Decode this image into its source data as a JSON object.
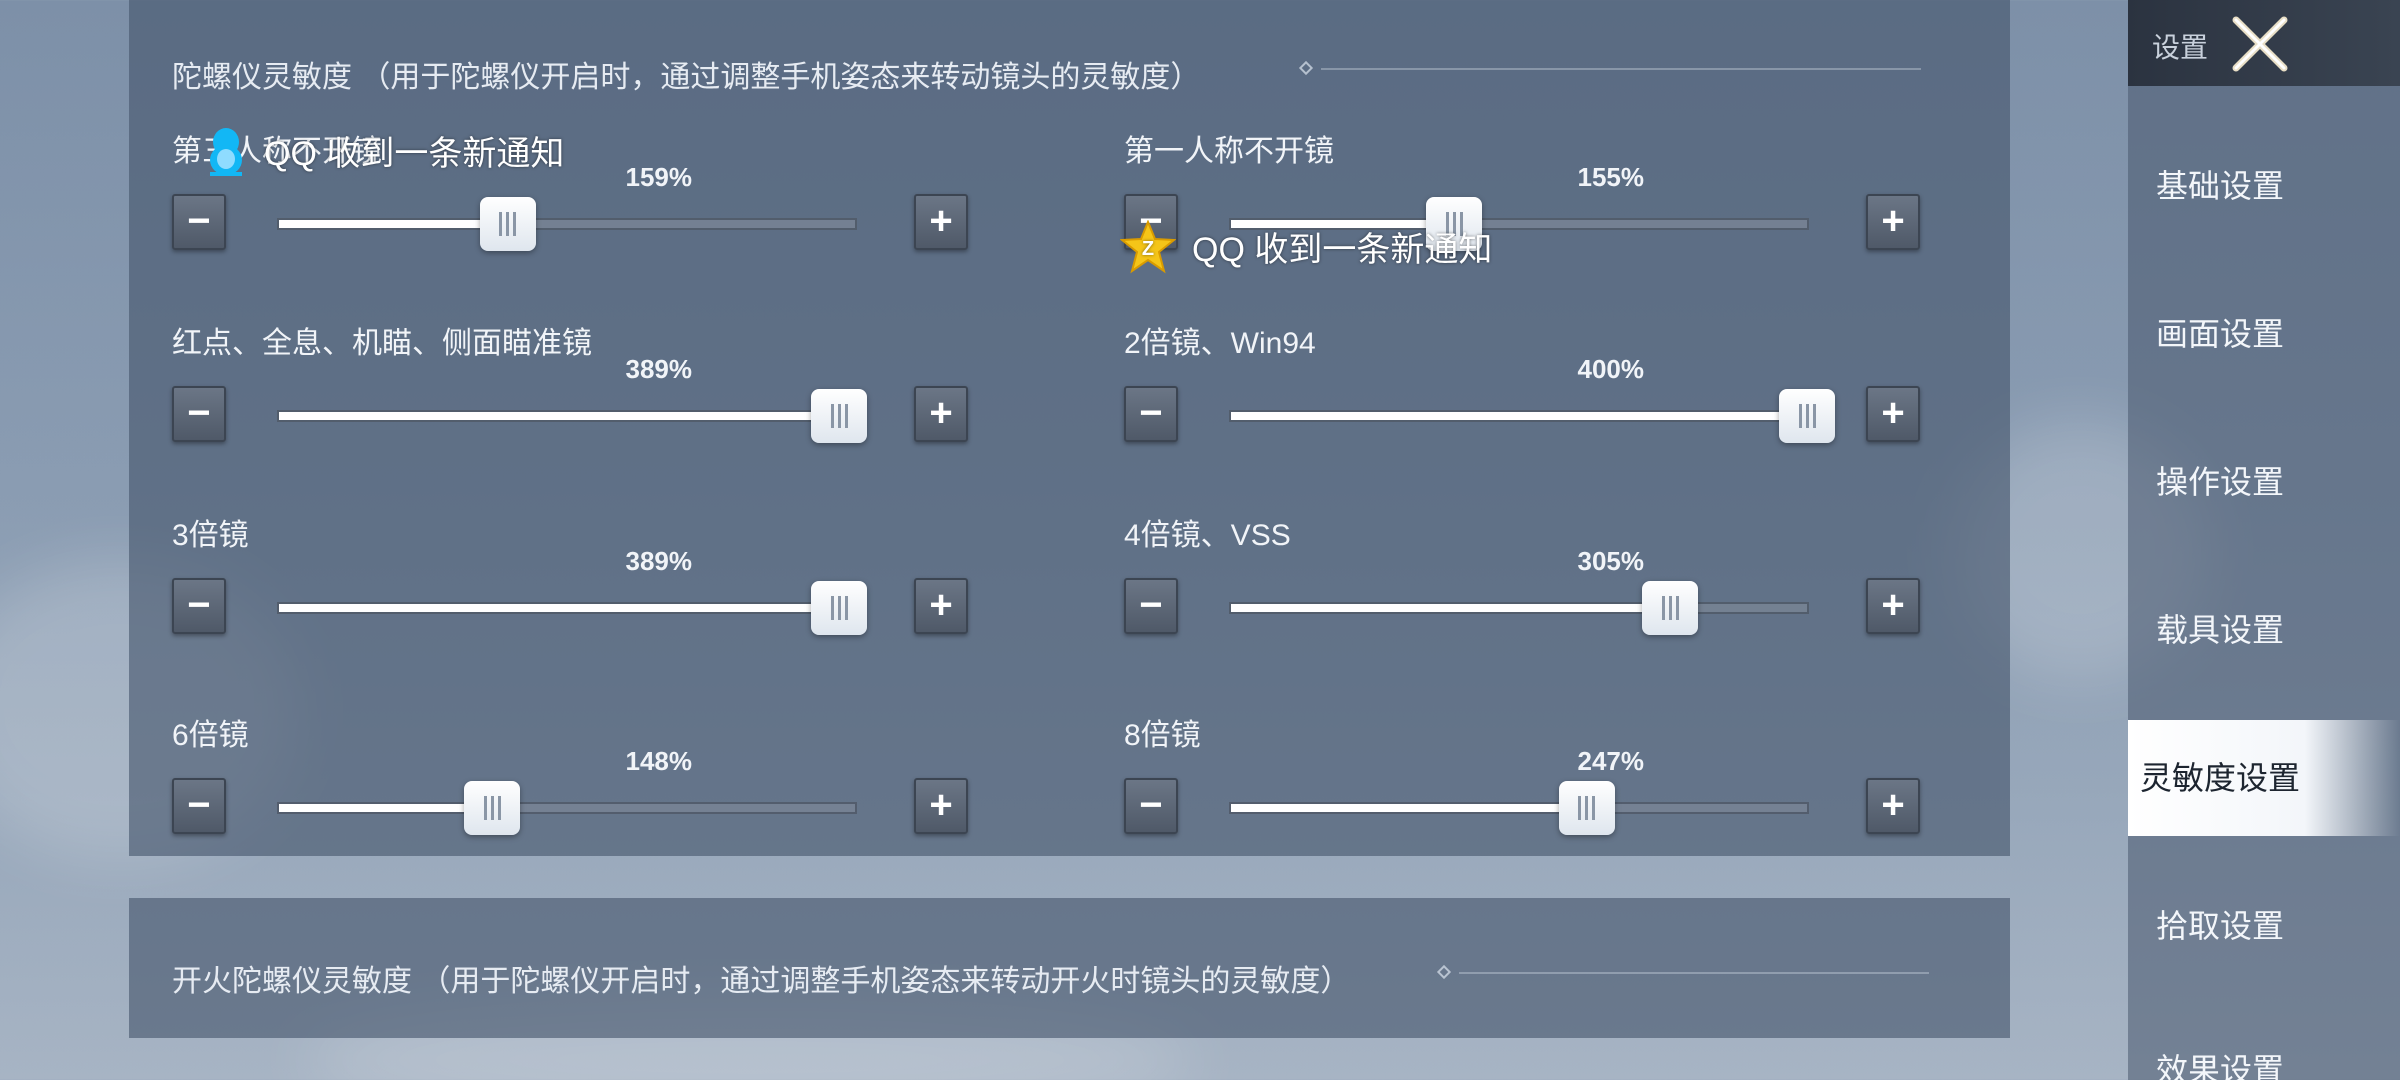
{
  "panels": {
    "gyro": {
      "title": "陀螺仪灵敏度 （用于陀螺仪开启时，通过调整手机姿态来转动镜头的灵敏度）",
      "settings": [
        {
          "label": "第三人称不开镜",
          "percent": "159%",
          "value": 159
        },
        {
          "label": "第一人称不开镜",
          "percent": "155%",
          "value": 155
        },
        {
          "label": "红点、全息、机瞄、侧面瞄准镜",
          "percent": "389%",
          "value": 389
        },
        {
          "label": "2倍镜、Win94",
          "percent": "400%",
          "value": 400
        },
        {
          "label": "3倍镜",
          "percent": "389%",
          "value": 389
        },
        {
          "label": "4倍镜、VSS",
          "percent": "305%",
          "value": 305
        },
        {
          "label": "6倍镜",
          "percent": "148%",
          "value": 148
        },
        {
          "label": "8倍镜",
          "percent": "247%",
          "value": 247
        }
      ],
      "slider_max": 400
    },
    "fire": {
      "title": "开火陀螺仪灵敏度 （用于陀螺仪开启时，通过调整手机姿态来转动开火时镜头的灵敏度）"
    }
  },
  "buttons": {
    "minus": "−",
    "plus": "+"
  },
  "sidebar": {
    "header": "设置",
    "items": [
      {
        "label": "基础设置"
      },
      {
        "label": "画面设置"
      },
      {
        "label": "操作设置"
      },
      {
        "label": "载具设置"
      },
      {
        "label": "灵敏度设置"
      },
      {
        "label": "拾取设置"
      },
      {
        "label": "效果设置"
      }
    ],
    "active_index": 4
  },
  "notifications": [
    {
      "text": "QQ 收到一条新通知",
      "icon": "qq-penguin-icon"
    },
    {
      "text": "QQ 收到一条新通知",
      "icon": "qzone-star-icon"
    }
  ],
  "colors": {
    "accent": "#ffffff",
    "panel": "#46566c",
    "qq_blue": "#12b7f5",
    "qzone_yellow": "#f5c518"
  }
}
